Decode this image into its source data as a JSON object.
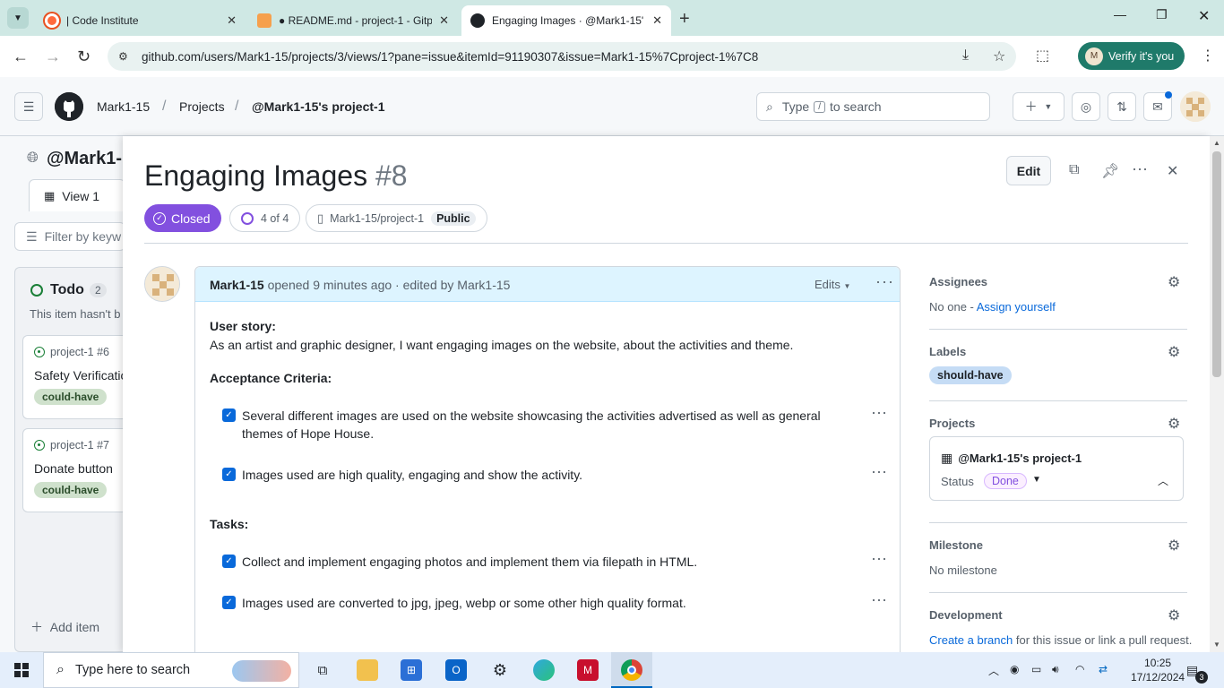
{
  "browser": {
    "tabs": [
      {
        "title": "| Code Institute",
        "active": false
      },
      {
        "title": "● README.md - project-1 - Gitp",
        "active": false
      },
      {
        "title": "Engaging Images · @Mark1-15'",
        "active": true
      }
    ],
    "url": "github.com/users/Mark1-15/projects/3/views/1?pane=issue&itemId=91190307&issue=Mark1-15%7Cproject-1%7C8",
    "verify_label": "Verify it's you",
    "verify_avatar": "M"
  },
  "header": {
    "breadcrumbs": [
      "Mark1-15",
      "Projects",
      "@Mark1-15's project-1"
    ],
    "search_prefix": "Type",
    "search_slash": "/",
    "search_suffix": "to search"
  },
  "board": {
    "title": "@Mark1-1",
    "view_tab": "View 1",
    "filter_placeholder": "Filter by keyw",
    "column": {
      "title": "Todo",
      "count": "2",
      "description": "This item hasn't b"
    },
    "cards": [
      {
        "ref": "project-1 #6",
        "title": "Safety Verificatio",
        "label": "could-have"
      },
      {
        "ref": "project-1 #7",
        "title": "Donate button",
        "label": "could-have"
      }
    ],
    "add_item": "Add item"
  },
  "issue": {
    "title": "Engaging Images",
    "number": "#8",
    "state": "Closed",
    "progress_label": "4 of 4",
    "repo": "Mark1-15/project-1",
    "visibility": "Public",
    "edit_label": "Edit",
    "comment": {
      "author": "Mark1-15",
      "meta": "opened 9 minutes ago · edited by Mark1-15",
      "edits_label": "Edits",
      "user_story_heading": "User story:",
      "user_story": "As an artist and graphic designer, I want engaging images on the website, about the activities and theme.",
      "acceptance_heading": "Acceptance Criteria:",
      "criteria": [
        {
          "text": "Several different images are used on the website showcasing the activities advertised as well as general themes of Hope House.",
          "checked": true
        },
        {
          "text": "Images used are high quality, engaging and show the activity.",
          "checked": true
        }
      ],
      "tasks_heading": "Tasks:",
      "tasks": [
        {
          "text": "Collect and implement engaging photos and implement them via filepath in HTML.",
          "checked": true
        },
        {
          "text": "Images used are converted to jpg, jpeg, webp or some other high quality format.",
          "checked": true
        }
      ]
    },
    "sidebar": {
      "assignees": {
        "title": "Assignees",
        "none": "No one - ",
        "assign_link": "Assign yourself"
      },
      "labels": {
        "title": "Labels",
        "items": [
          "should-have"
        ]
      },
      "projects": {
        "title": "Projects",
        "name": "@Mark1-15's project-1",
        "status_label": "Status",
        "status_value": "Done"
      },
      "milestone": {
        "title": "Milestone",
        "value": "No milestone"
      },
      "development": {
        "title": "Development",
        "link": "Create a branch",
        "text": " for this issue or link a pull request."
      }
    }
  },
  "taskbar": {
    "search_placeholder": "Type here to search",
    "time": "10:25",
    "date": "17/12/2024",
    "notification_count": "3"
  },
  "colors": {
    "closed_purple": "#8250df",
    "link_blue": "#0969da",
    "header_blue": "#ddf4ff",
    "could_have_green": "#cfe1cc",
    "should_have_blue": "#c5dcf5"
  }
}
